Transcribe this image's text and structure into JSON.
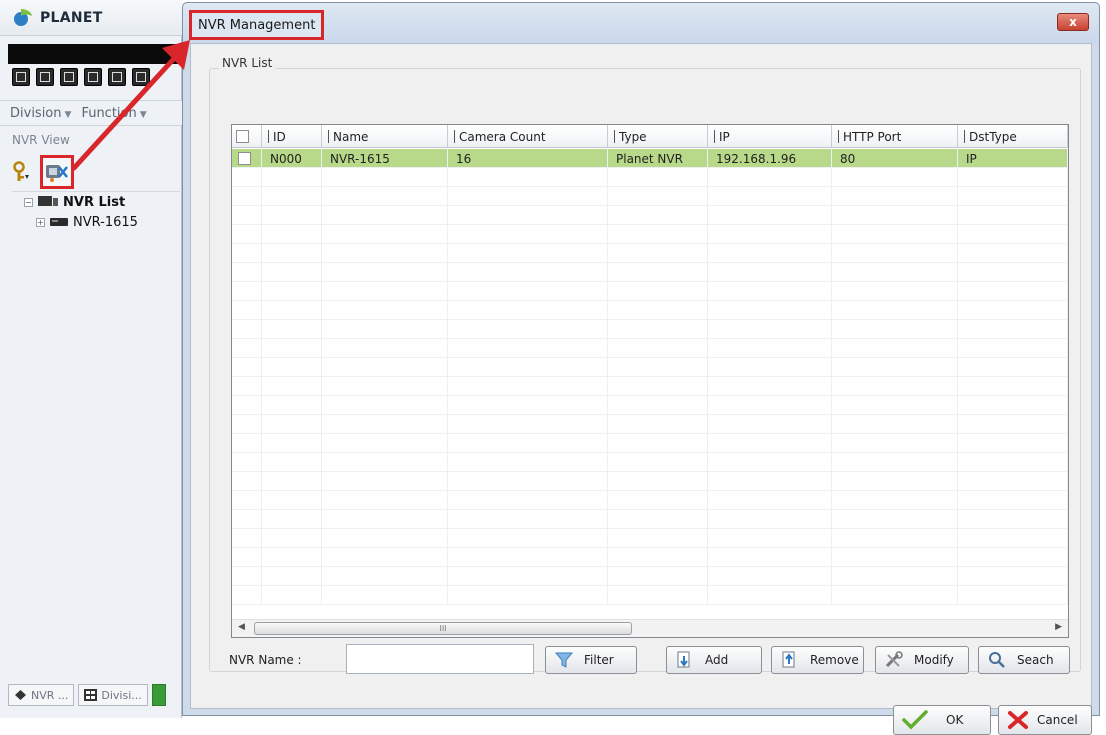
{
  "background_app": {
    "title": "PLANET",
    "menus": [
      {
        "label": "Division"
      },
      {
        "label": "Function"
      }
    ],
    "panel_label": "NVR View",
    "tree": {
      "root_label": "NVR List",
      "child_label": "NVR-1615"
    },
    "bottom_tabs": [
      {
        "label": "NVR ..."
      },
      {
        "label": "Divisi..."
      }
    ]
  },
  "dialog": {
    "title": "NVR Management",
    "close_label": "x",
    "group_label": "NVR List",
    "columns": [
      "ID",
      "Name",
      "Camera Count",
      "Type",
      "IP",
      "HTTP Port",
      "DstType"
    ],
    "rows": [
      {
        "id": "N000",
        "name": "NVR-1615",
        "camera_count": "16",
        "type": "Planet NVR",
        "ip": "192.168.1.96",
        "http_port": "80",
        "dst_type": "IP",
        "selected": true
      }
    ],
    "scroll_grip": "III",
    "nvr_name_label": "NVR Name :",
    "nvr_name_value": "",
    "buttons": {
      "filter": "Filter",
      "add": "Add",
      "remove": "Remove",
      "modify": "Modify",
      "search": "Seach",
      "ok": "OK",
      "cancel": "Cancel"
    }
  },
  "colors": {
    "selected_row": "#b8d88a",
    "annotation_red": "#d8262a",
    "dialog_frame": "#cfdbe9"
  }
}
